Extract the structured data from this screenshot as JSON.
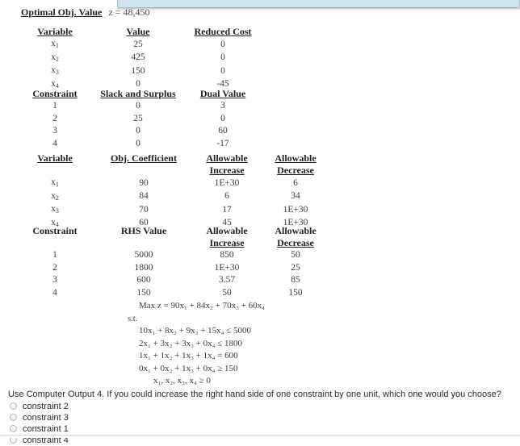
{
  "top_bar": {
    "name": "highlighted-field",
    "color": "#cfe4ea"
  },
  "report": {
    "optimal": {
      "label": "Optimal Obj. Value",
      "value": "z = 48,450"
    },
    "variable_table": {
      "headers": [
        "Variable",
        "Value",
        "Reduced Cost"
      ],
      "rows": [
        {
          "variable": "x",
          "sub": "1",
          "value": "25",
          "reduced_cost": "0"
        },
        {
          "variable": "x",
          "sub": "2",
          "value": "425",
          "reduced_cost": "0"
        },
        {
          "variable": "x",
          "sub": "3",
          "value": "150",
          "reduced_cost": "0"
        },
        {
          "variable": "x",
          "sub": "4",
          "value": "0",
          "reduced_cost": "-45"
        }
      ]
    },
    "constraint_table": {
      "headers": [
        "Constraint",
        "Slack and Surplus",
        "Dual Value"
      ],
      "rows": [
        {
          "constraint": "1",
          "slack": "0",
          "dual": "3"
        },
        {
          "constraint": "2",
          "slack": "25",
          "dual": "0"
        },
        {
          "constraint": "3",
          "slack": "0",
          "dual": "60"
        },
        {
          "constraint": "4",
          "slack": "0",
          "dual": "-17"
        }
      ]
    },
    "obj_coef_table": {
      "headers": [
        "Variable",
        "Obj. Coefficient",
        "Allowable",
        "Allowable"
      ],
      "subheaders": [
        "",
        "",
        "Increase",
        "Decrease"
      ],
      "rows": [
        {
          "variable": "x",
          "sub": "1",
          "coef": "90",
          "increase": "1E+30",
          "decrease": "6"
        },
        {
          "variable": "x",
          "sub": "2",
          "coef": "84",
          "increase": "6",
          "decrease": "34"
        },
        {
          "variable": "x",
          "sub": "3",
          "coef": "70",
          "increase": "17",
          "decrease": "1E+30"
        },
        {
          "variable": "x",
          "sub": "4",
          "coef": "60",
          "increase": "45",
          "decrease": "1E+30"
        }
      ]
    },
    "rhs_table": {
      "headers": [
        "Constraint",
        "RHS Value",
        "Allowable",
        "Allowable"
      ],
      "subheaders": [
        "",
        "",
        "Increase",
        "Decrease"
      ],
      "rows": [
        {
          "constraint": "1",
          "rhs": "5000",
          "increase": "850",
          "decrease": "50"
        },
        {
          "constraint": "2",
          "rhs": "1800",
          "increase": "1E+30",
          "decrease": "25"
        },
        {
          "constraint": "3",
          "rhs": "600",
          "increase": "3.57",
          "decrease": "85"
        },
        {
          "constraint": "4",
          "rhs": "150",
          "increase": "50",
          "decrease": "150"
        }
      ]
    }
  },
  "model": {
    "objective": "Max z = 90x₁ + 84x₂ + 70x₃ + 60x₄",
    "subject_to_label": "s.t.",
    "constraints": [
      "10x₁ + 8x₂ + 9x₃ + 15x₄ ≤ 5000",
      "2x₁ + 3x₂ + 3x₃ + 0x₄ ≤ 1800",
      "1x₁ + 1x₂ + 1x₃ + 1x₄ = 600",
      "0x₁ + 0x₂ + 1x₃ + 0x₄ ≥ 150"
    ],
    "nonnegativity": "x₁, x₂, x₃, x₄ ≥ 0"
  },
  "question": {
    "text": "Use Computer Output 4. If you could increase the right hand side of one constraint by one unit, which one would you choose?",
    "options": [
      {
        "label": "constraint 2",
        "selected": false
      },
      {
        "label": "constraint 3",
        "selected": false
      },
      {
        "label": "constraint 1",
        "selected": false
      },
      {
        "label": "constraint 4",
        "selected": false
      }
    ]
  }
}
